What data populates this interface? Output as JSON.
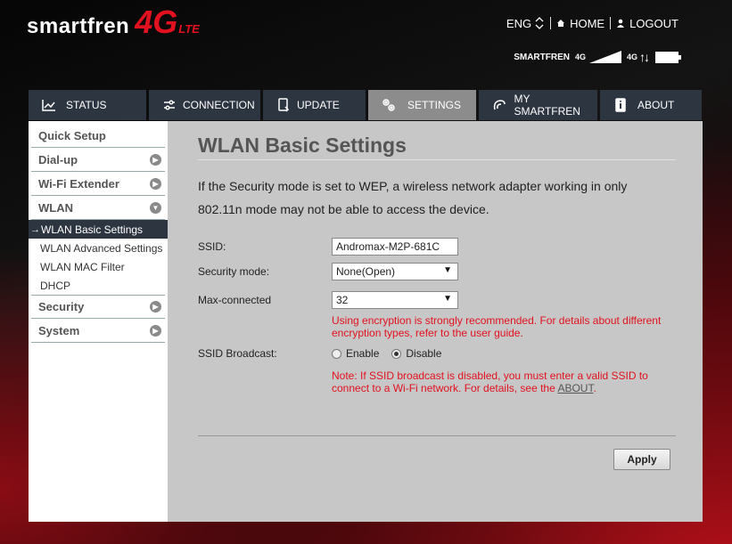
{
  "brand": {
    "word": "smartfren",
    "fourg": "4G",
    "lte": "LTE"
  },
  "header": {
    "lang": "ENG",
    "home": "HOME",
    "logout": "LOGOUT"
  },
  "status": {
    "operator": "SMARTFREN",
    "signal_net": "4G",
    "net": "4G"
  },
  "nav": {
    "tabs": [
      {
        "label": "STATUS",
        "icon": "chart-line-icon"
      },
      {
        "label": "CONNECTION",
        "icon": "sliders-icon"
      },
      {
        "label": "UPDATE",
        "icon": "device-update-icon"
      },
      {
        "label": "SETTINGS",
        "icon": "gears-icon",
        "active": true
      },
      {
        "label": "MY SMARTFREN",
        "icon": "smartfren-logo-icon"
      },
      {
        "label": "ABOUT",
        "icon": "info-icon"
      }
    ]
  },
  "sidebar": {
    "quick_setup": "Quick Setup",
    "dialup": "Dial-up",
    "wifi_extender": "Wi-Fi Extender",
    "wlan": "WLAN",
    "wlan_basic": "WLAN Basic Settings",
    "wlan_advanced": "WLAN Advanced Settings",
    "wlan_mac": "WLAN MAC Filter",
    "dhcp": "DHCP",
    "security": "Security",
    "system": "System"
  },
  "main": {
    "title": "WLAN Basic Settings",
    "description": "If the Security mode is set to WEP, a wireless network adapter working in only 802.11n mode may not be able to access the device.",
    "ssid_label": "SSID:",
    "ssid_value": "Andromax-M2P-681C",
    "security_label": "Security mode:",
    "security_value": "None(Open)",
    "maxconn_label": "Max-connected",
    "maxconn_value": "32",
    "encryption_warning": "Using encryption is strongly recommended. For details about different encryption types, refer to the user guide.",
    "broadcast_label": "SSID Broadcast:",
    "enable_label": "Enable",
    "disable_label": "Disable",
    "broadcast_selected": "Disable",
    "broadcast_note": "Note: If SSID broadcast is disabled, you must enter a valid SSID to connect to a Wi-Fi network. For details, see the",
    "about_link": "ABOUT",
    "note_end": ".",
    "apply": "Apply"
  },
  "colors": {
    "brand_red": "#e2111f",
    "nav_bg": "#2d3540",
    "nav_active": "#8c8c8c",
    "content_bg": "#c7c7c7"
  }
}
